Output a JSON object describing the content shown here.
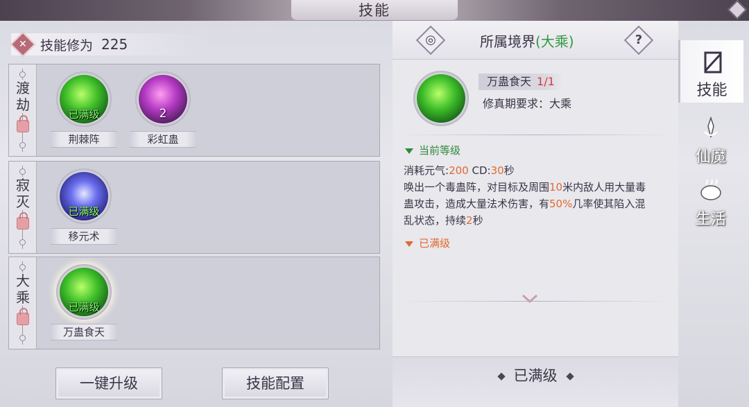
{
  "header": {
    "title": "技能"
  },
  "cultivation": {
    "label": "技能修为",
    "value": "225"
  },
  "realms": [
    {
      "name": "渡劫",
      "skills": [
        {
          "label": "荆棘阵",
          "status": "已满级",
          "color": "green"
        },
        {
          "label": "彩虹蛊",
          "status": "2",
          "color": "purple"
        }
      ]
    },
    {
      "name": "寂灭",
      "skills": [
        {
          "label": "移元术",
          "status": "已满级",
          "color": "blue"
        }
      ]
    },
    {
      "name": "大乘",
      "skills": [
        {
          "label": "万蛊食天",
          "status": "已满级",
          "color": "green"
        }
      ]
    }
  ],
  "buttons": {
    "upgrade_all": "一键升级",
    "skill_config": "技能配置"
  },
  "detail": {
    "realm_label": "所属境界",
    "realm_value": "(大乘)",
    "help": "?",
    "skill_name": "万蛊食天",
    "skill_level": "1/1",
    "requirement": "修真期要求：大乘",
    "current_level_label": "当前等级",
    "desc_cost_prefix": "消耗元气:",
    "desc_cost_value": "200",
    "desc_cd_prefix": " CD:",
    "desc_cd_value": "30",
    "desc_cd_suffix": "秒",
    "desc_line_a": "唤出一个毒蛊阵，对目标及周围",
    "desc_range": "10",
    "desc_line_b": "米内敌人用大量毒蛊攻击，造成大量法术伤害，有",
    "desc_chance": "50%",
    "desc_line_c": "几率使其陷入混乱状态，持续",
    "desc_duration": "2",
    "desc_line_d": "秒",
    "maxed_label": "已满级",
    "footer_status": "已满级"
  },
  "tabs": [
    {
      "label": "技能",
      "icon": "scroll-icon",
      "active": true
    },
    {
      "label": "仙魔",
      "icon": "sword-icon",
      "active": false
    },
    {
      "label": "生活",
      "icon": "pot-icon",
      "active": false
    }
  ],
  "colors": {
    "accent_green": "#2f9a3f",
    "accent_orange": "#e06a2e",
    "level_red": "#d23c3c"
  }
}
